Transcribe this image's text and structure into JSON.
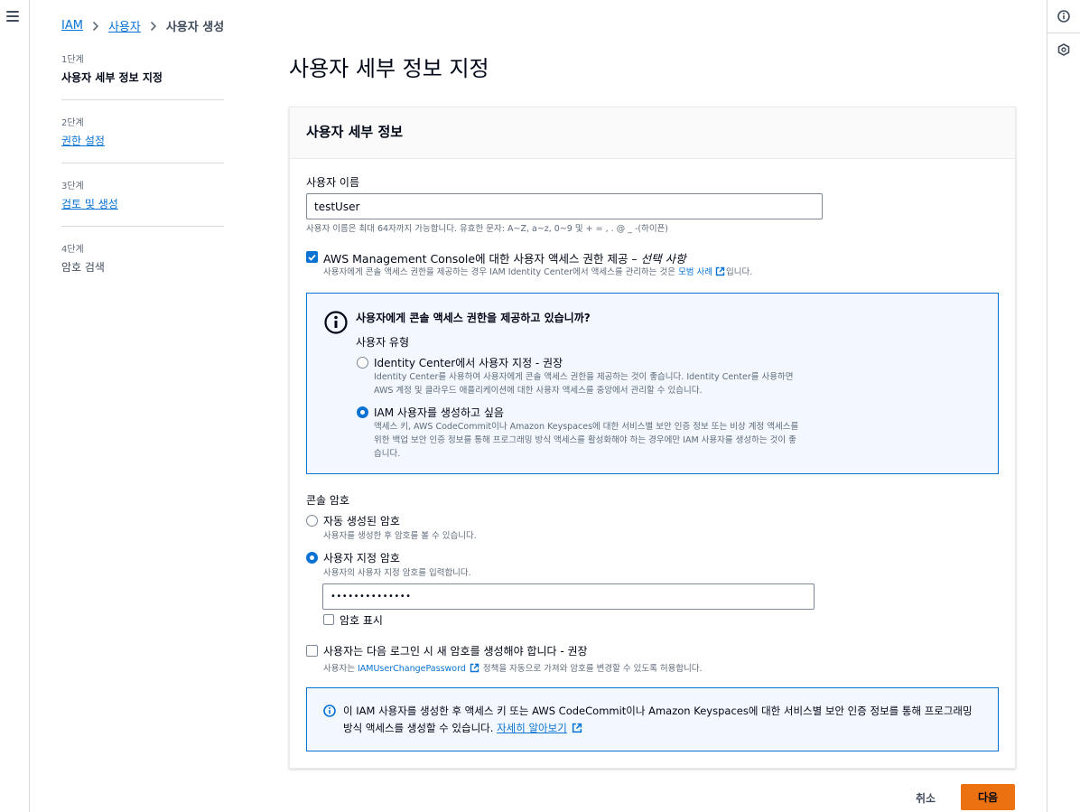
{
  "breadcrumb": {
    "root": "IAM",
    "parent": "사용자",
    "current": "사용자 생성"
  },
  "steps": [
    {
      "num": "1단계",
      "title": "사용자 세부 정보 지정"
    },
    {
      "num": "2단계",
      "title": "권한 설정"
    },
    {
      "num": "3단계",
      "title": "검토 및 생성"
    },
    {
      "num": "4단계",
      "title": "암호 검색"
    }
  ],
  "page_title": "사용자 세부 정보 지정",
  "panel": {
    "header": "사용자 세부 정보",
    "username": {
      "label": "사용자 이름",
      "value": "testUser",
      "hint": "사용자 이름은 최대 64자까지 가능합니다. 유효한 문자: A~Z, a~z, 0~9 및 + = , . @ _ -(하이픈)"
    },
    "console_access": {
      "label_main": "AWS Management Console에 대한 사용자 액세스 권한 제공 – ",
      "label_optional": "선택 사항",
      "desc_pre": "사용자에게 콘솔 액세스 권한을 제공하는 경우 IAM Identity Center에서 액세스를 관리하는 것은 ",
      "desc_link": "모범 사례",
      "desc_post": "입니다."
    },
    "info": {
      "title": "사용자에게 콘솔 액세스 권한을 제공하고 있습니까?",
      "user_type_label": "사용자 유형",
      "opt1_title": "Identity Center에서 사용자 지정 - 권장",
      "opt1_desc_line1": "Identity Center를 사용하여 사용자에게 콘솔 액세스 권한을 제공하는 것이 좋습니다. Identity Center를 사용하면",
      "opt1_desc_line2": "AWS 계정 및 클라우드 애플리케이션에 대한 사용자 액세스를 중앙에서 관리할 수 있습니다.",
      "opt2_title": "IAM 사용자를 생성하고 싶음",
      "opt2_desc_line1": "액세스 키, AWS CodeCommit이나 Amazon Keyspaces에 대한 서비스별 보안 인증 정보 또는 비상 계정 액세스를",
      "opt2_desc_line2": "위한 백업 보안 인증 정보를 통해 프로그래밍 방식 액세스를 활성화해야 하는 경우에만 IAM 사용자를 생성하는 것이 좋",
      "opt2_desc_line3": "습니다."
    },
    "password": {
      "label": "콘솔 암호",
      "auto_title": "자동 생성된 암호",
      "auto_desc": "사용자를 생성한 후 암호를 볼 수 있습니다.",
      "custom_title": "사용자 지정 암호",
      "custom_desc": "사용자의 사용자 지정 암호를 입력합니다.",
      "value": "••••••••••••••",
      "show_label": "암호 표시"
    },
    "reset": {
      "title": "사용자는 다음 로그인 시 새 암호를 생성해야 합니다 - 권장",
      "desc_pre": "사용자는 ",
      "desc_link": "IAMUserChangePassword",
      "desc_post": " 정책을 자동으로 가져와 암호를 변경할 수 있도록 허용합니다."
    },
    "bottom_info": {
      "line1": "이 IAM 사용자를 생성한 후 액세스 키 또는 AWS CodeCommit이나 Amazon Keyspaces에 대한 서비스별 보안 인증 정보를 통해 프로그래밍",
      "line2_pre": "방식 액세스를 생성할 수 있습니다. ",
      "link": "자세히 알아보기"
    }
  },
  "actions": {
    "cancel": "취소",
    "next": "다음"
  },
  "colors": {
    "accent": "#0972d3",
    "primary_button": "#ec7211",
    "info_bg": "#f2f8fd"
  },
  "icons": [
    "menu-icon",
    "info-icon",
    "hexagon-icon",
    "chevron-right-icon",
    "external-link-icon",
    "check-icon"
  ]
}
